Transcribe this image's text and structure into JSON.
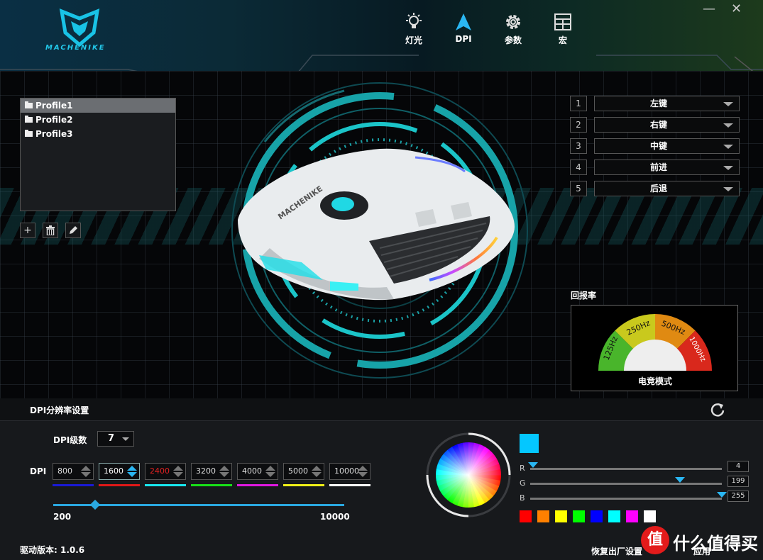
{
  "app": {
    "logo_text": "MACHENIKE"
  },
  "nav": [
    {
      "label": "灯光",
      "icon": "bulb-icon"
    },
    {
      "label": "DPI",
      "icon": "arrow-icon"
    },
    {
      "label": "参数",
      "icon": "gear-icon"
    },
    {
      "label": "宏",
      "icon": "grid-icon"
    }
  ],
  "window": {
    "minimize": "—",
    "close": "✕"
  },
  "profiles": {
    "items": [
      "Profile1",
      "Profile2",
      "Profile3"
    ],
    "active_index": 0
  },
  "profile_tools": {
    "add": "+",
    "delete": "🗑",
    "edit": "✎"
  },
  "buttons": [
    {
      "num": "1",
      "value": "左键"
    },
    {
      "num": "2",
      "value": "右键"
    },
    {
      "num": "3",
      "value": "中键"
    },
    {
      "num": "4",
      "value": "前进"
    },
    {
      "num": "5",
      "value": "后退"
    }
  ],
  "polling": {
    "title": "回报率",
    "options": [
      "125Hz",
      "250Hz",
      "500Hz",
      "1000Hz"
    ],
    "mode": "电竞模式",
    "colors": {
      "125Hz": "#49b52b",
      "250Hz": "#c9c91d",
      "500Hz": "#e08a12",
      "1000Hz": "#d9281c"
    }
  },
  "dpi": {
    "section_title": "DPI分辨率设置",
    "level_label": "DPI级数",
    "level_value": "7",
    "row_label": "DPI",
    "stages": [
      {
        "value": "800",
        "color": "#1a1ad6",
        "text_color": "#dddddd"
      },
      {
        "value": "1600",
        "color": "#e01818",
        "text_color": "#ffffff",
        "selected": true
      },
      {
        "value": "2400",
        "color": "#18e8f0",
        "text_color": "#e02020"
      },
      {
        "value": "3200",
        "color": "#18e018",
        "text_color": "#dddddd"
      },
      {
        "value": "4000",
        "color": "#e018e0",
        "text_color": "#dddddd"
      },
      {
        "value": "5000",
        "color": "#f0f018",
        "text_color": "#dddddd"
      },
      {
        "value": "10000",
        "color": "#ffffff",
        "text_color": "#dddddd"
      }
    ],
    "slider_min": "200",
    "slider_max": "10000",
    "slider_value": 1600
  },
  "color": {
    "current": "#04c7ff",
    "r": "4",
    "g": "199",
    "b": "255",
    "r_label": "R",
    "g_label": "G",
    "b_label": "B",
    "palette": [
      "#ff0000",
      "#ff8000",
      "#ffff00",
      "#00ff00",
      "#0000ff",
      "#00ffff",
      "#ff00ff",
      "#ffffff"
    ]
  },
  "footer": {
    "version": "驱动版本: 1.0.6",
    "factory_reset": "恢复出厂设置",
    "apply": "应用",
    "watermark_glyph": "值",
    "watermark_text": "什么值得买"
  }
}
